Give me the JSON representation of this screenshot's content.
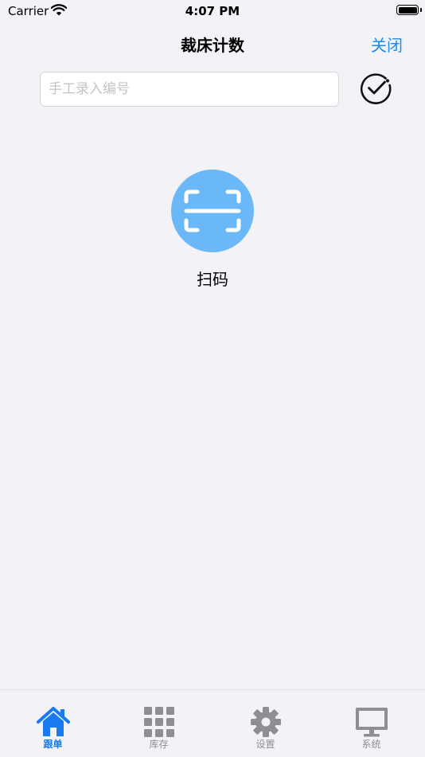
{
  "status_bar": {
    "carrier": "Carrier",
    "time": "4:07 PM"
  },
  "nav": {
    "title": "裁床计数",
    "close_label": "关闭"
  },
  "code_input": {
    "value": "",
    "placeholder": "手工录入编号"
  },
  "scan": {
    "label": "扫码"
  },
  "tabs": [
    {
      "label": "跟单",
      "icon": "home-icon",
      "active": true
    },
    {
      "label": "库存",
      "icon": "grid-icon",
      "active": false
    },
    {
      "label": "设置",
      "icon": "gear-icon",
      "active": false
    },
    {
      "label": "系统",
      "icon": "monitor-icon",
      "active": false
    }
  ],
  "colors": {
    "accent": "#1A8CF0",
    "scan_button": "#6AB8F7",
    "tab_active": "#1A7AF0",
    "tab_inactive": "#8E8E93",
    "background": "#F2F2F7"
  }
}
